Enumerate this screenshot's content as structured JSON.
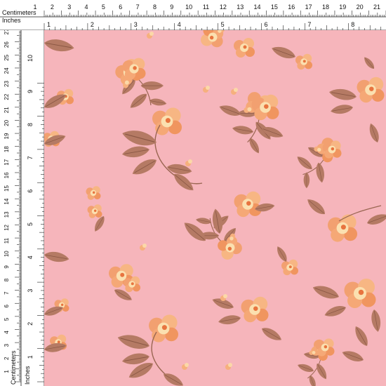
{
  "ruler": {
    "top_cm_label": "Centimeters",
    "top_in_label": "Inches",
    "left_cm_label": "Centimeters",
    "left_in_label": "Inches",
    "cm_ticks": [
      "1",
      "2",
      "3",
      "4",
      "5",
      "6",
      "7",
      "8",
      "9",
      "10",
      "11",
      "12",
      "13",
      "14",
      "15",
      "16",
      "17",
      "18",
      "19",
      "20",
      "21"
    ],
    "in_ticks": [
      "1",
      "2",
      "3",
      "4",
      "5",
      "6",
      "7",
      "8"
    ],
    "left_cm_ticks": [
      "1",
      "2",
      "3",
      "4",
      "5",
      "6",
      "7",
      "8",
      "9",
      "10",
      "11",
      "12",
      "13",
      "14",
      "15",
      "16",
      "17",
      "18",
      "19",
      "20",
      "21",
      "22",
      "23",
      "24",
      "25",
      "26",
      "27"
    ],
    "left_in_ticks": [
      "1",
      "2",
      "3",
      "4",
      "5",
      "6",
      "7",
      "8",
      "9",
      "10"
    ]
  },
  "fabric": {
    "background_color": "#f6b5bb",
    "leaf_color": "#b57a64",
    "flower_color": "#f2a070",
    "flower_highlight": "#fbe0b0",
    "pattern": "scattered orange flowers with brown leaves"
  }
}
